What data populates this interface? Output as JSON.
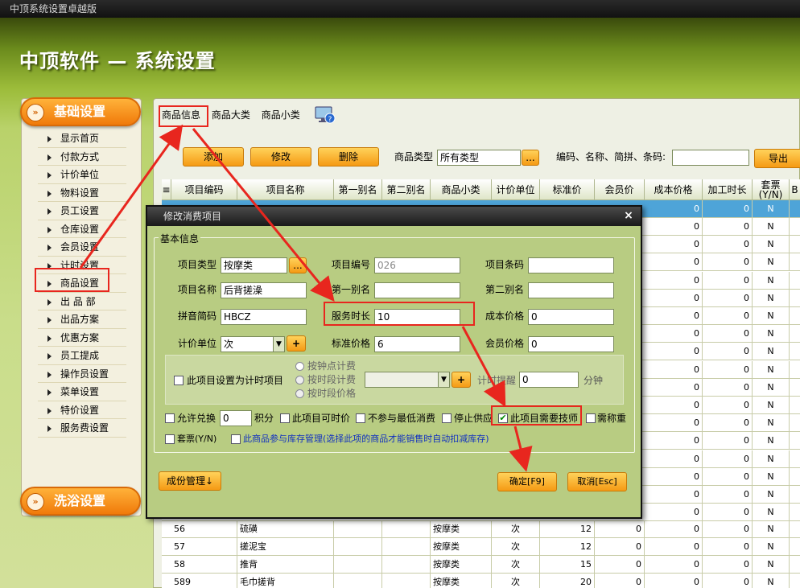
{
  "window": {
    "title": "中顶系统设置卓越版"
  },
  "app": {
    "heading": "中顶软件 — 系统设置"
  },
  "sidebar": {
    "header_basic": "基础设置",
    "header_bath": "洗浴设置",
    "items": [
      "显示首页",
      "付款方式",
      "计价单位",
      "物料设置",
      "员工设置",
      "仓库设置",
      "会员设置",
      "计时设置",
      "商品设置",
      "出 品 部",
      "出品方案",
      "优惠方案",
      "员工提成",
      "操作员设置",
      "菜单设置",
      "特价设置",
      "服务费设置"
    ]
  },
  "tabs": [
    "商品信息",
    "商品大类",
    "商品小类"
  ],
  "toolbar": {
    "add": "添加",
    "edit": "修改",
    "delete": "删除",
    "type_label": "商品类型",
    "type_value": "所有类型",
    "type_picker": "...",
    "search_label": "编码、名称、简拼、条码:",
    "search_value": "",
    "export": "导出"
  },
  "table": {
    "columns": [
      "项目编码",
      "项目名称",
      "第一别名",
      "第二别名",
      "商品小类",
      "计价单位",
      "标准价",
      "会员价",
      "成本价格",
      "加工时长",
      "套票(Y/N)",
      "B"
    ],
    "first_row": {
      "cost": "0",
      "time": "0",
      "ticket": "N"
    },
    "side_rows": [
      {
        "cost": "0",
        "time": "0",
        "ticket": "N"
      },
      {
        "cost": "0",
        "time": "0",
        "ticket": "N"
      },
      {
        "cost": "0",
        "time": "0",
        "ticket": "N"
      },
      {
        "cost": "0",
        "time": "0",
        "ticket": "N"
      },
      {
        "cost": "0",
        "time": "0",
        "ticket": "N"
      },
      {
        "cost": "0",
        "time": "0",
        "ticket": "N"
      },
      {
        "cost": "0",
        "time": "0",
        "ticket": "N"
      },
      {
        "cost": "0",
        "time": "0",
        "ticket": "N"
      },
      {
        "cost": "0",
        "time": "0",
        "ticket": "N"
      },
      {
        "cost": "0",
        "time": "0",
        "ticket": "N"
      },
      {
        "cost": "0",
        "time": "0",
        "ticket": "N"
      },
      {
        "cost": "0",
        "time": "0",
        "ticket": "N"
      },
      {
        "cost": "0",
        "time": "0",
        "ticket": "N"
      },
      {
        "cost": "0",
        "time": "0",
        "ticket": "N"
      },
      {
        "cost": "0",
        "time": "0",
        "ticket": "N"
      },
      {
        "cost": "0",
        "time": "0",
        "ticket": "N"
      },
      {
        "cost": "0",
        "time": "0",
        "ticket": "N"
      }
    ],
    "rows": [
      {
        "code": "56",
        "name": "硫磺",
        "alias1": "",
        "alias2": "",
        "sub": "按摩类",
        "unit": "次",
        "price": "12",
        "member": "0",
        "cost": "0",
        "time": "0",
        "ticket": "N"
      },
      {
        "code": "57",
        "name": "搓泥宝",
        "alias1": "",
        "alias2": "",
        "sub": "按摩类",
        "unit": "次",
        "price": "12",
        "member": "0",
        "cost": "0",
        "time": "0",
        "ticket": "N"
      },
      {
        "code": "58",
        "name": "推背",
        "alias1": "",
        "alias2": "",
        "sub": "按摩类",
        "unit": "次",
        "price": "15",
        "member": "0",
        "cost": "0",
        "time": "0",
        "ticket": "N"
      },
      {
        "code": "589",
        "name": "毛巾搓背",
        "alias1": "",
        "alias2": "",
        "sub": "按摩类",
        "unit": "次",
        "price": "20",
        "member": "0",
        "cost": "0",
        "time": "0",
        "ticket": "N"
      }
    ]
  },
  "dialog": {
    "title": "修改消费项目",
    "close": "×",
    "group": "基本信息",
    "type_label": "项目类型",
    "type_value": "按摩类",
    "type_btn": "...",
    "code_label": "项目编号",
    "code_value": "026",
    "barcode_label": "项目条码",
    "barcode_value": "",
    "name_label": "项目名称",
    "name_value": "后背搓澡",
    "alias1_label": "第一别名",
    "alias1_value": "",
    "alias2_label": "第二别名",
    "alias2_value": "",
    "pinyin_label": "拼音简码",
    "pinyin_value": "HBCZ",
    "duration_label": "服务时长",
    "duration_value": "10",
    "cost_label": "成本价格",
    "cost_value": "0",
    "unit_label": "计价单位",
    "unit_value": "次",
    "unit_add": "+",
    "std_label": "标准价格",
    "std_value": "6",
    "member_label": "会员价格",
    "member_value": "0",
    "timer_check": "此项目设置为计时项目",
    "radio1": "按钟点计费",
    "radio2": "按时段计费",
    "radio3": "按时段价格",
    "timer_add": "+",
    "remind_label": "计时提醒",
    "remind_value": "0",
    "minute": "分钟",
    "opt_exchange": "允许兑换",
    "points_value": "0",
    "points_label": "积分",
    "opt_timeprice": "此项目可时价",
    "opt_nomin": "不参与最低消费",
    "opt_stop": "停止供应",
    "opt_tech": "此项目需要技师",
    "opt_weigh": "需称重",
    "opt_ticket": "套票(Y/N)",
    "opt_stock": "此商品参与库存管理(选择此项的商品才能销售时自动扣减库存)",
    "components_btn": "成份管理↓",
    "ok_btn": "确定[F9]",
    "cancel_btn": "取消[Esc]"
  },
  "colors": {
    "accent_orange": "#f59a14",
    "highlight_red": "#e8261e",
    "selection_blue": "#4ea4d8"
  }
}
